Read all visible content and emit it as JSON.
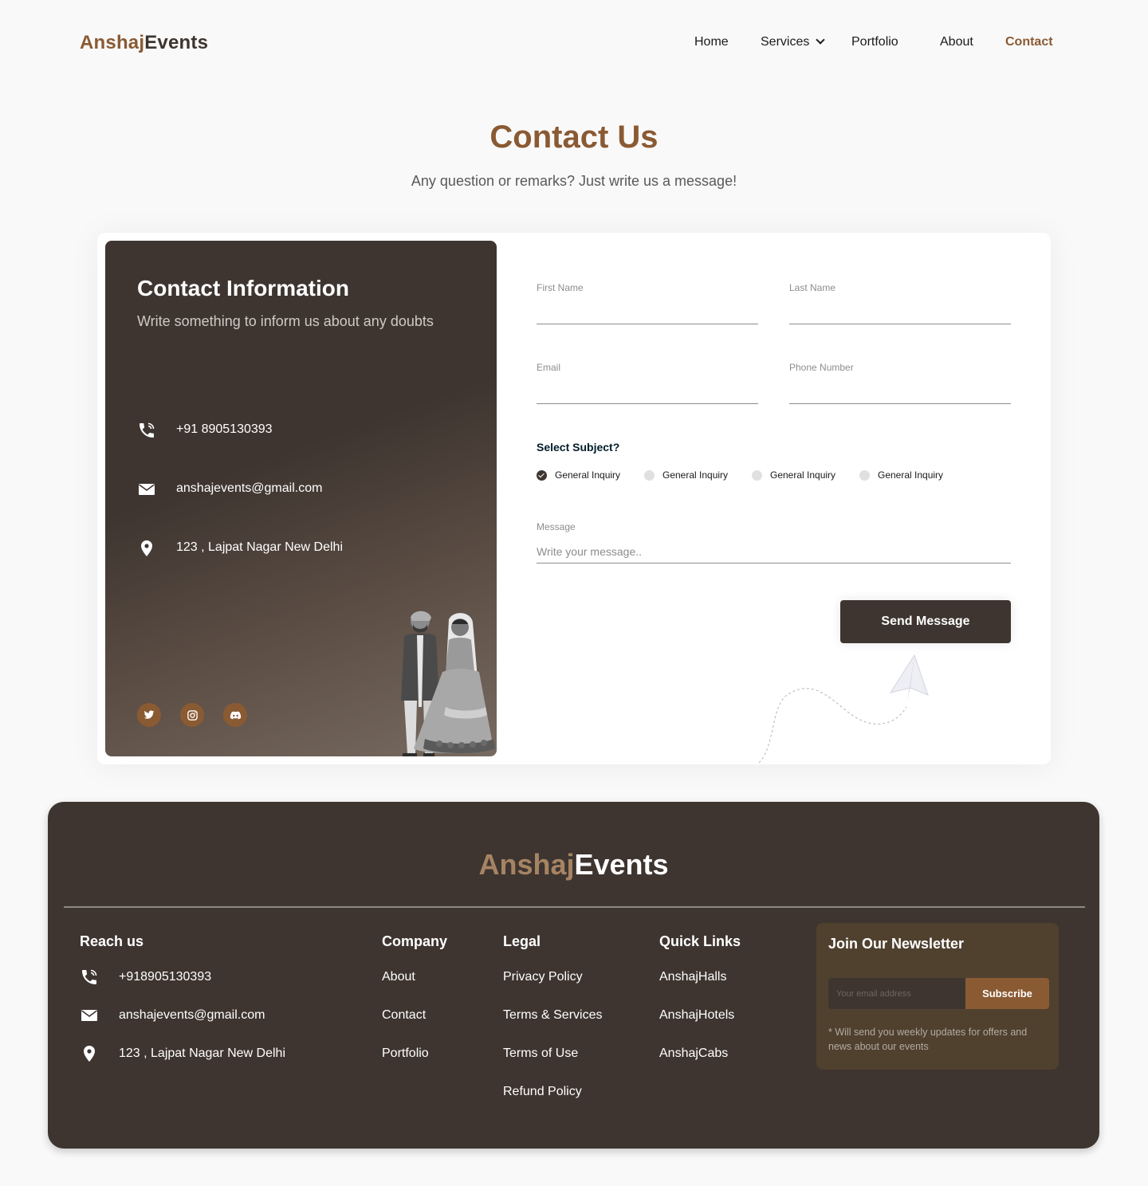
{
  "brand": {
    "part1": "Anshaj",
    "part2": "Events"
  },
  "nav": {
    "home": "Home",
    "services": "Services",
    "portfolio": "Portfolio",
    "about": "About",
    "contact": "Contact"
  },
  "hero": {
    "title": "Contact Us",
    "subtitle": "Any question or remarks? Just write us a message!"
  },
  "contact_info": {
    "title": "Contact Information",
    "subtitle": "Write something to inform us about any doubts",
    "phone": "+91 8905130393",
    "email": "anshajevents@gmail.com",
    "address": "123 , Lajpat Nagar New Delhi",
    "socials": [
      "twitter-icon",
      "instagram-icon",
      "discord-icon"
    ]
  },
  "form": {
    "first_name_label": "First Name",
    "last_name_label": "Last Name",
    "email_label": "Email",
    "phone_label": "Phone Number",
    "subject_label": "Select Subject?",
    "subjects": [
      {
        "label": "General Inquiry",
        "selected": true
      },
      {
        "label": "General Inquiry",
        "selected": false
      },
      {
        "label": "General Inquiry",
        "selected": false
      },
      {
        "label": "General Inquiry",
        "selected": false
      }
    ],
    "message_label": "Message",
    "message_placeholder": "Write your message..",
    "send_label": "Send Message"
  },
  "footer": {
    "reach_us": {
      "heading": "Reach us",
      "phone": "+918905130393",
      "email": "anshajevents@gmail.com",
      "address": "123 , Lajpat Nagar New Delhi"
    },
    "company": {
      "heading": "Company",
      "links": [
        "About",
        "Contact",
        "Portfolio"
      ]
    },
    "legal": {
      "heading": "Legal",
      "links": [
        "Privacy Policy",
        "Terms & Services",
        "Terms of Use",
        "Refund Policy"
      ]
    },
    "quick_links": {
      "heading": "Quick Links",
      "links": [
        "AnshajHalls",
        "AnshajHotels",
        "AnshajCabs"
      ]
    },
    "newsletter": {
      "title": "Join Our Newsletter",
      "placeholder": "Your email address",
      "button": "Subscribe",
      "note": "* Will send you weekly updates for offers and news about our events"
    }
  },
  "colors": {
    "accent": "#8a5a33",
    "dark": "#3e3530",
    "footer_logo_accent": "#a68463"
  }
}
